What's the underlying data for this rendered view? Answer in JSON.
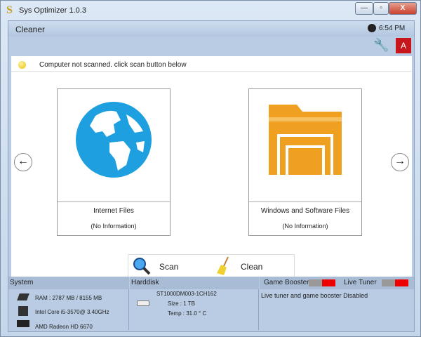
{
  "window": {
    "title": "Sys Optimizer 1.0.3",
    "app_icon": "S",
    "controls": {
      "minimize": "—",
      "maximize": "▫",
      "close": "X"
    }
  },
  "header": {
    "section": "Cleaner",
    "time": "6:54 PM",
    "clock_icon": "clock-icon",
    "tools_icon": "wrench-icon",
    "account_button": "A",
    "account_color": "#c8161d"
  },
  "status": {
    "text": "Computer not scanned. click scan button below",
    "indicator_color": "#e8c000"
  },
  "cards": [
    {
      "title": "Internet Files",
      "subtitle": "(No Information)",
      "icon": "globe-icon",
      "color": "#1ea0e0"
    },
    {
      "title": "Windows and Software Files",
      "subtitle": "(No Information)",
      "icon": "folder-icon",
      "color": "#f0a020"
    }
  ],
  "nav": {
    "prev": "←",
    "next": "→"
  },
  "actions": {
    "scan": "Scan",
    "clean": "Clean"
  },
  "info": {
    "system": {
      "heading": "System",
      "ram": "RAM : 2787 MB / 8155 MB",
      "cpu": "Intel Core i5-3570@ 3.40GHz",
      "gpu": "AMD Radeon HD 6670"
    },
    "harddisk": {
      "heading": "Harddisk",
      "model": "ST1000DM003-1CH162",
      "size": "Size : 1 TB",
      "temp": "Temp : 31.0 ° C"
    },
    "boost": {
      "game_booster": "Game Booster",
      "live_tuner": "Live Tuner",
      "game_booster_on": false,
      "live_tuner_on": false,
      "message": "Live tuner and game booster Disabled"
    }
  }
}
